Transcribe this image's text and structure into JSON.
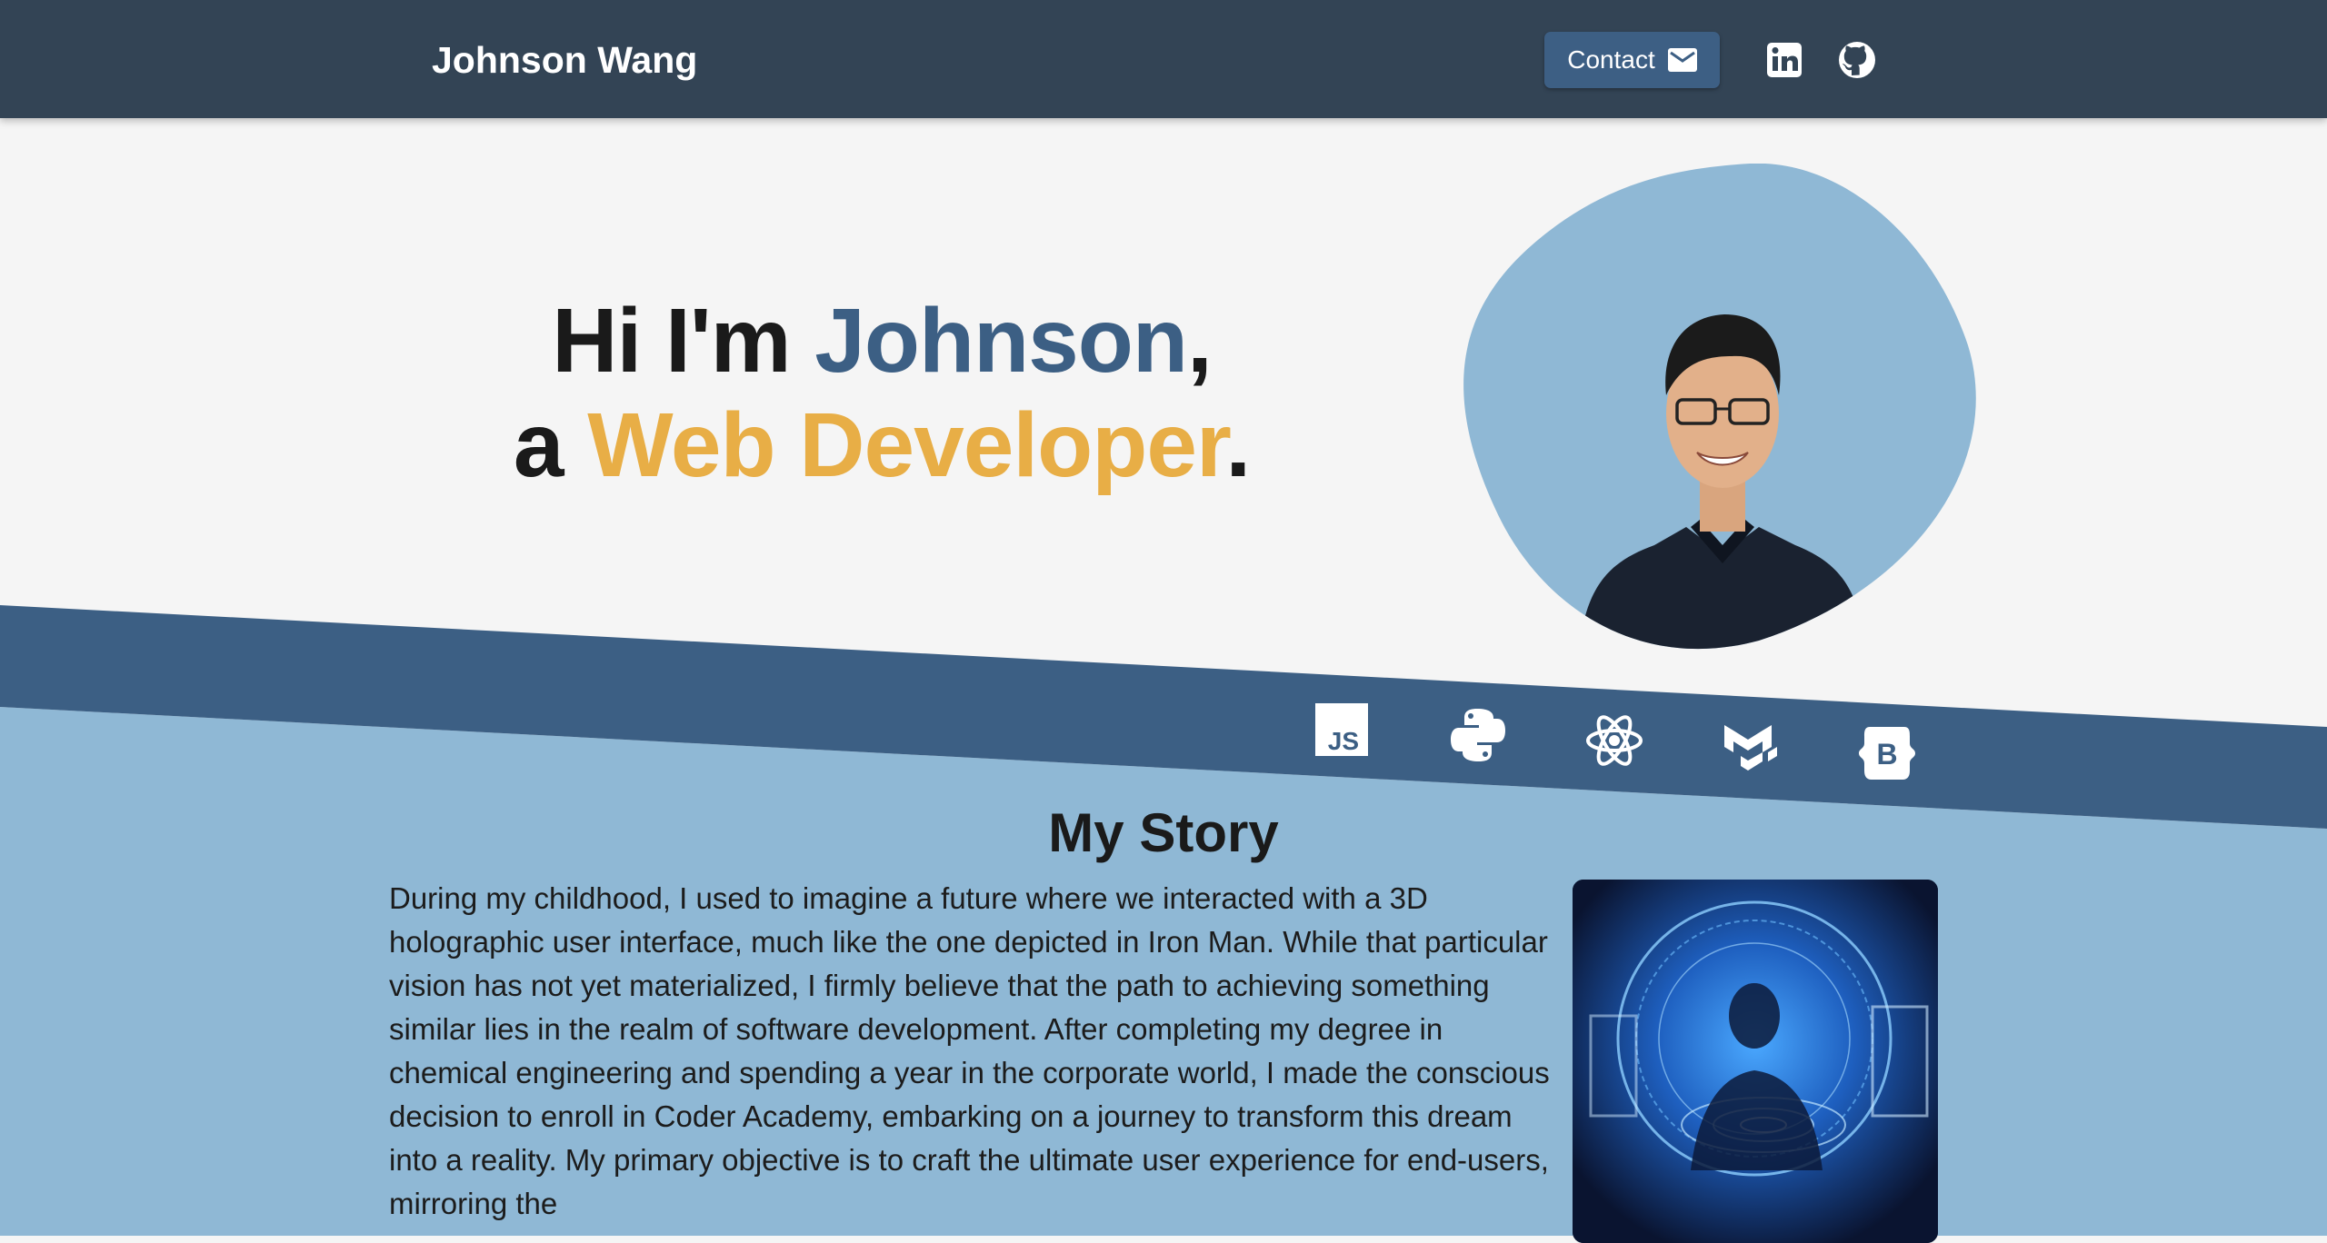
{
  "header": {
    "brand": "Johnson Wang",
    "contact_label": "Contact",
    "social": [
      "linkedin-icon",
      "github-icon"
    ]
  },
  "hero": {
    "line1_prefix": "Hi I'm ",
    "line1_name": "Johnson",
    "line1_suffix": ",",
    "line2_prefix": "a ",
    "line2_role": "Web Developer",
    "line2_suffix": "."
  },
  "tech_icons": [
    "javascript-icon",
    "python-icon",
    "react-icon",
    "material-ui-icon",
    "bootstrap-icon"
  ],
  "story": {
    "title": "My Story",
    "text": "During my childhood, I used to imagine a future where we interacted with a 3D holographic user interface, much like the one depicted in Iron Man. While that particular vision has not yet materialized, I firmly believe that the path to achieving something similar lies in the realm of software development. After completing my degree in chemical engineering and spending a year in the corporate world, I made the conscious decision to enroll in Coder Academy, embarking on a journey to transform this dream into a reality. My primary objective is to craft the ultimate user experience for end-users, mirroring the"
  },
  "colors": {
    "header_bg": "#334455",
    "accent_blue": "#3c5f84",
    "accent_yellow": "#e8ae46",
    "light_blue": "#8fb8d5",
    "page_bg": "#f5f5f5"
  }
}
